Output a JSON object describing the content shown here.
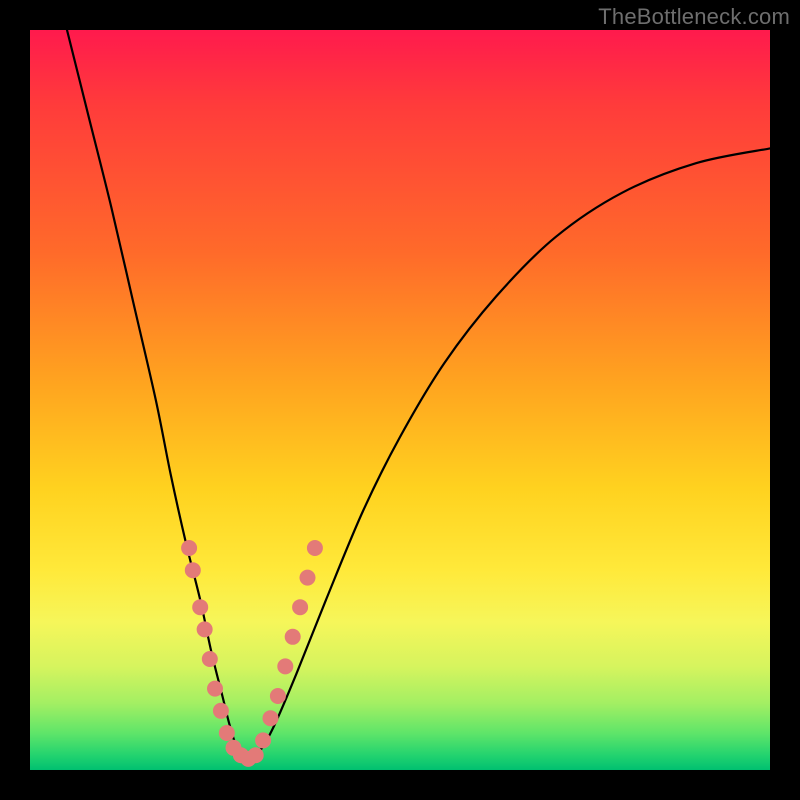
{
  "watermark": "TheBottleneck.com",
  "colors": {
    "frame": "#000000",
    "curve": "#000000",
    "dot": "#e37a78",
    "gradient_top": "#ff1a4d",
    "gradient_bottom": "#00c070"
  },
  "chart_data": {
    "type": "line",
    "title": "",
    "xlabel": "",
    "ylabel": "",
    "xlim": [
      0,
      100
    ],
    "ylim": [
      0,
      100
    ],
    "grid": false,
    "legend": false,
    "series": [
      {
        "name": "bottleneck-curve",
        "x": [
          5,
          8,
          11,
          14,
          17,
          19,
          21,
          23,
          24.5,
          26,
          27,
          28,
          29.5,
          31,
          33,
          36,
          40,
          45,
          50,
          56,
          63,
          71,
          80,
          90,
          100
        ],
        "y": [
          100,
          88,
          76,
          63,
          50,
          40,
          31,
          23,
          16,
          10,
          6,
          3,
          1.5,
          2.5,
          6,
          13,
          23,
          35,
          45,
          55,
          64,
          72,
          78,
          82,
          84
        ]
      }
    ],
    "dots": {
      "name": "highlighted-points",
      "points": [
        {
          "x": 21.5,
          "y": 30
        },
        {
          "x": 22.0,
          "y": 27
        },
        {
          "x": 23.0,
          "y": 22
        },
        {
          "x": 23.6,
          "y": 19
        },
        {
          "x": 24.3,
          "y": 15
        },
        {
          "x": 25.0,
          "y": 11
        },
        {
          "x": 25.8,
          "y": 8
        },
        {
          "x": 26.6,
          "y": 5
        },
        {
          "x": 27.5,
          "y": 3
        },
        {
          "x": 28.5,
          "y": 2
        },
        {
          "x": 29.5,
          "y": 1.5
        },
        {
          "x": 30.5,
          "y": 2
        },
        {
          "x": 31.5,
          "y": 4
        },
        {
          "x": 32.5,
          "y": 7
        },
        {
          "x": 33.5,
          "y": 10
        },
        {
          "x": 34.5,
          "y": 14
        },
        {
          "x": 35.5,
          "y": 18
        },
        {
          "x": 36.5,
          "y": 22
        },
        {
          "x": 37.5,
          "y": 26
        },
        {
          "x": 38.5,
          "y": 30
        }
      ]
    },
    "background": {
      "type": "vertical-gradient",
      "meaning": "performance-heatmap",
      "top_color": "#ff1a4d",
      "bottom_color": "#00c070"
    }
  }
}
